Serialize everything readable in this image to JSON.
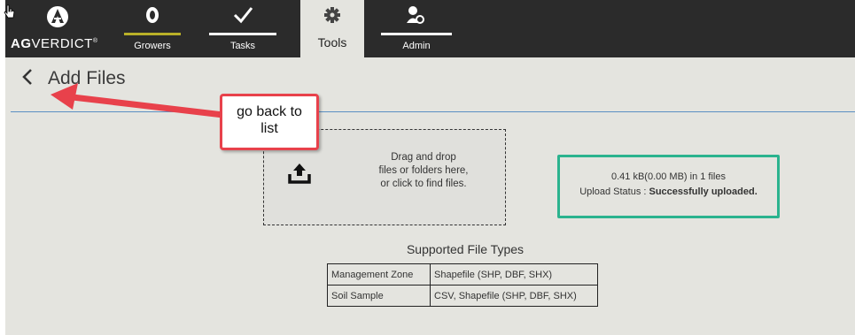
{
  "brand": {
    "bold": "AG",
    "rest": "VERDICT"
  },
  "nav": {
    "tabs": [
      {
        "label": "Growers",
        "icon": "grower-icon",
        "bar_color": "#b9b028"
      },
      {
        "label": "Tasks",
        "icon": "checkmark-icon",
        "bar_color": "#ffffff"
      },
      {
        "label": "Tools",
        "icon": "gear-icon",
        "active": true
      },
      {
        "label": "Admin",
        "icon": "admin-user-icon",
        "bar_color": "#ffffff"
      }
    ]
  },
  "page": {
    "title": "Add Files",
    "back_icon": "chevron-left-icon"
  },
  "dropzone": {
    "line1": "Drag and drop",
    "line2": "files or folders here,",
    "line3": "or click to find files.",
    "icon": "upload-icon"
  },
  "upload_status": {
    "size_text": "0.41 kB(0.00 MB) in  1 files",
    "status_label": "Upload Status : ",
    "status_value": "Successfully uploaded.",
    "border_color": "#2bb38e"
  },
  "file_types": {
    "title": "Supported File Types",
    "rows": [
      {
        "type": "Management Zone",
        "formats": "Shapefile (SHP, DBF, SHX)"
      },
      {
        "type": "Soil Sample",
        "formats": "CSV, Shapefile (SHP, DBF, SHX)"
      }
    ]
  },
  "annotation": {
    "line1": "go back to",
    "line2": "list",
    "color": "#e8414b"
  }
}
